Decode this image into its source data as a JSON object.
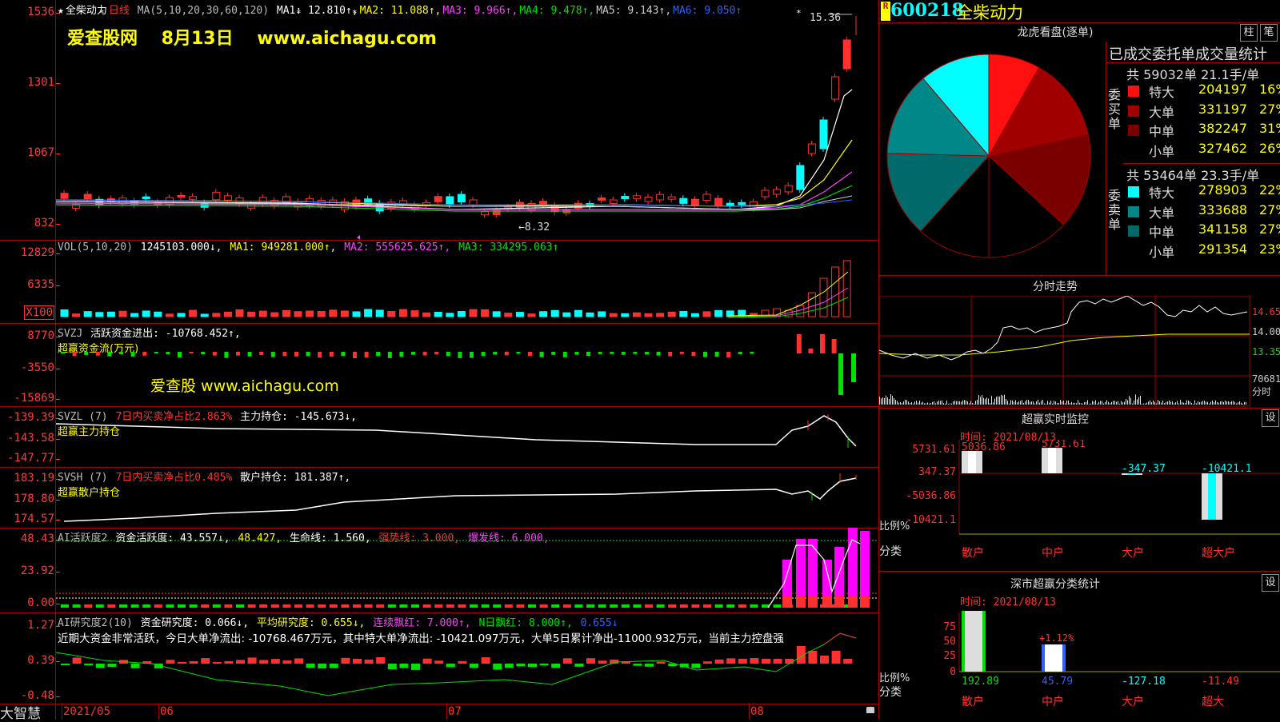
{
  "stock": {
    "code": "600218",
    "name": "全柴动力",
    "period_label": "日线",
    "badge": "R"
  },
  "watermarks": {
    "top": "爱查股网　 8月13日　 www.aichagu.com",
    "mid": "爱查股 www.aichagu.com"
  },
  "kline": {
    "title": "全柴动力",
    "ma_prefix": "MA(5,10,20,30,60,120)",
    "ma": [
      {
        "label": "MA1: 12.810↑,",
        "color": "#ffffff"
      },
      {
        "label": "MA2: 11.088↑,",
        "color": "#ffff00"
      },
      {
        "label": "MA3: 9.966↑,",
        "color": "#ff40ff"
      },
      {
        "label": "MA4: 9.478↑,",
        "color": "#00e000"
      },
      {
        "label": "MA5: 9.143↑,",
        "color": "#cccccc"
      },
      {
        "label": "MA6: 9.050↑",
        "color": "#3060ff"
      }
    ],
    "y_labels": [
      "1536",
      "1301",
      "1067",
      "832"
    ],
    "high_label": "15.36",
    "low_label": "8.32"
  },
  "vol": {
    "header_prefix": "VOL(5,10,20)",
    "main": "1245103.000↓,",
    "ma1": "MA1: 949281.000↑,",
    "ma2": "MA2: 555625.625↑,",
    "ma3": "MA3: 334295.063↑",
    "y_labels": [
      "12829",
      "6335"
    ],
    "unit": "X100"
  },
  "svzj": {
    "line1_a": "SVZJ",
    "line1_b": "活跃资金进出: -10768.452↑,",
    "line2": "超赢资金流(万元)",
    "y_labels": [
      "8770",
      "-3550",
      "-15869"
    ]
  },
  "svzl": {
    "line1_a": "SVZL (7)",
    "line1_b": "7日内买卖净占比2.863%",
    "line1_c": "主力持仓: -145.673↓,",
    "line2": "超赢主力持仓",
    "y_labels": [
      "-139.39",
      "-143.58",
      "-147.77"
    ]
  },
  "svsh": {
    "line1_a": "SVSH (7)",
    "line1_b": "7日内买卖净占比0.485%",
    "line1_c": "散户持仓: 181.387↑,",
    "line2": "超赢散户持仓",
    "y_labels": [
      "183.19",
      "178.80",
      "174.57"
    ]
  },
  "ai_active": {
    "a": "AI活跃度2",
    "b": "资金活跃度: 43.557↓,",
    "c": "48.427,",
    "d": "生命线: 1.560,",
    "e": "强势线: 3.000,",
    "f": "爆发线: 6.000,",
    "y_labels": [
      "48.43",
      "23.92",
      "0.00"
    ]
  },
  "ai_research": {
    "a": "AI研究度2(10)",
    "b": "资金研究度: 0.066↓,",
    "c": "平均研究度: 0.655↓,",
    "d": "连续飘红: 7.000↑,",
    "e": "N日飘红: 8.000↑,",
    "f": "0.655↓",
    "comment": "近期大资金非常活跃，今日大单净流出: -10768.467万元，其中特大单净流出: -10421.097万元，大单5日累计净出-11000.932万元，当前主力控盘强",
    "y_labels": [
      "1.27",
      "0.39",
      "-0.48"
    ]
  },
  "x_axis": {
    "labels": [
      "2021/05",
      "06",
      "07",
      "08"
    ],
    "brand": "大智慧"
  },
  "tabs": {
    "a": "柱",
    "b": "笔"
  },
  "dragon": {
    "title": "龙虎看盘(逐单)",
    "subtitle": "已成交委托单成交量统计",
    "buy_summary": "共 59032单 21.1手/单",
    "sell_summary": "共 53464单 23.3手/单",
    "buy_label": "委买单",
    "sell_label": "委卖单",
    "buy": [
      {
        "label": "特大",
        "value": "204197",
        "pct": "16%",
        "color": "#ff1010"
      },
      {
        "label": "大单",
        "value": "331197",
        "pct": "27%",
        "color": "#a00000"
      },
      {
        "label": "中单",
        "value": "382247",
        "pct": "31%",
        "color": "#7a0000"
      },
      {
        "label": "小单",
        "value": "327462",
        "pct": "26%",
        "color": "#000000"
      }
    ],
    "sell": [
      {
        "label": "特大",
        "value": "278903",
        "pct": "22%",
        "color": "#00ffff"
      },
      {
        "label": "大单",
        "value": "333688",
        "pct": "27%",
        "color": "#008888"
      },
      {
        "label": "中单",
        "value": "341158",
        "pct": "27%",
        "color": "#006a6a"
      },
      {
        "label": "小单",
        "value": "291354",
        "pct": "23%",
        "color": "#000000"
      }
    ]
  },
  "intraday": {
    "title": "分时走势",
    "y_labels": [
      "14.65",
      "14.00",
      "13.35"
    ],
    "vol_label": "70681",
    "vol_unit": "分时"
  },
  "monitor": {
    "title": "超赢实时监控",
    "btn": "设",
    "time": "时间: 2021/08/13",
    "y_labels": [
      "5731.61",
      "347.37",
      "-5036.86",
      "-10421.1"
    ],
    "ratio_label": "比例%",
    "class_label": "分类",
    "bars": [
      {
        "cat": "散户",
        "value": "5036.86"
      },
      {
        "cat": "中户",
        "value": "5731.61"
      },
      {
        "cat": "大户",
        "value": "-347.37"
      },
      {
        "cat": "超大户",
        "value": "-10421.1"
      }
    ]
  },
  "shenzhen": {
    "title": "深市超赢分类统计",
    "btn": "设",
    "time": "时间: 2021/08/13",
    "y_labels": [
      "75",
      "50",
      "25",
      "0"
    ],
    "ratio_label": "比例%",
    "class_label": "分类",
    "note": "+1.12%",
    "bars": [
      {
        "cat": "散户",
        "value": "192.89"
      },
      {
        "cat": "中户",
        "value": "45.79"
      },
      {
        "cat": "大户",
        "value": "-127.18"
      },
      {
        "cat": "超大",
        "value": "-11.49"
      }
    ]
  }
}
